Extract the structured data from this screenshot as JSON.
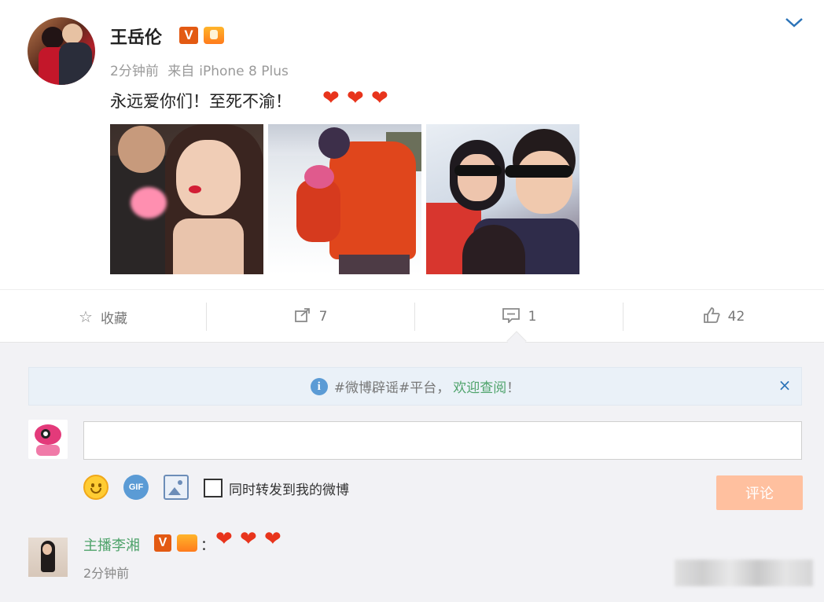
{
  "post": {
    "username": "王岳伦",
    "verified_mark": "V",
    "time": "2分钟前",
    "source_prefix": "来自",
    "source_device": "iPhone 8 Plus",
    "text": "永远爱你们！至死不渝！",
    "hearts": [
      "❤",
      "❤",
      "❤"
    ],
    "photos": [
      "photo-1",
      "photo-2",
      "photo-3"
    ],
    "collapse_icon": "chevron-down-icon"
  },
  "actions": {
    "favorite_label": "收藏",
    "favorite_icon": "star-icon",
    "repost_count": "7",
    "repost_icon": "share-icon",
    "comment_count": "1",
    "comment_icon": "comment-icon",
    "like_count": "42",
    "like_icon": "thumbs-up-icon"
  },
  "notice": {
    "text": "#微博辟谣#平台，",
    "link": "欢迎查阅",
    "suffix": "！",
    "close": "×"
  },
  "composer": {
    "input_value": "",
    "gif_label": "GIF",
    "checkbox_label": "同时转发到我的微博",
    "submit_label": "评论"
  },
  "reply": {
    "name": "主播李湘",
    "verified_mark": "V",
    "colon": "：",
    "hearts": [
      "❤",
      "❤",
      "❤"
    ],
    "time": "2分钟前"
  },
  "colors": {
    "accent_link": "#4fa36b",
    "verified_badge": "#e35a13",
    "heart": "#e8341c",
    "submit_disabled": "#ffc09f",
    "chevron_blue": "#2b73b8"
  }
}
